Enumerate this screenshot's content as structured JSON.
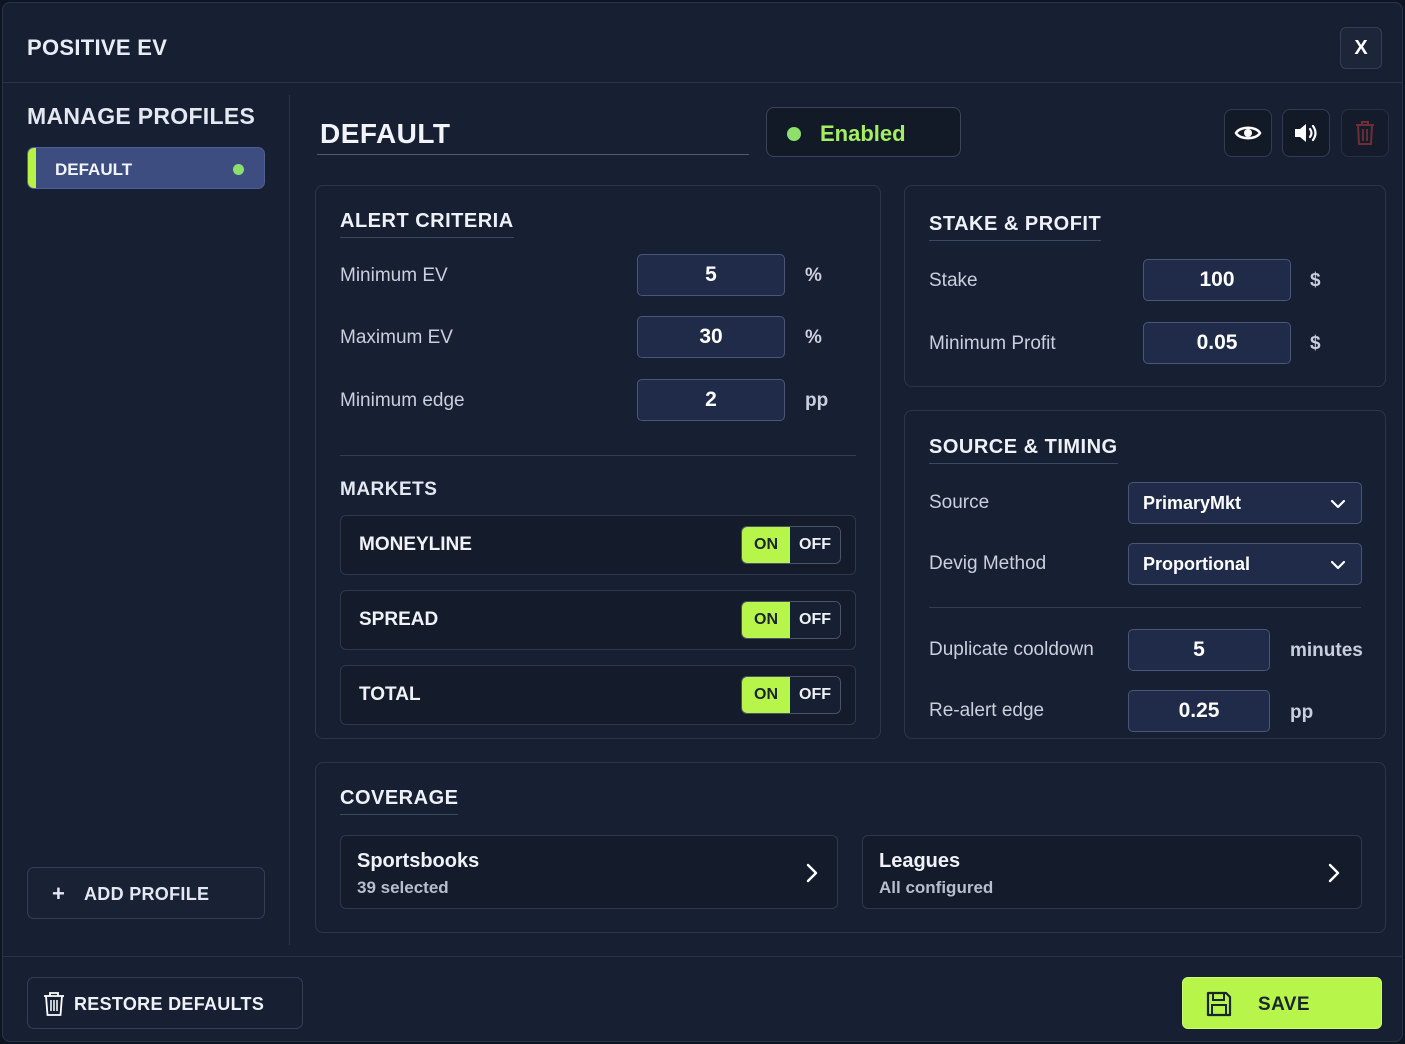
{
  "window": {
    "title": "POSITIVE EV",
    "close_label": "X"
  },
  "sidebar": {
    "title": "MANAGE PROFILES",
    "profiles": [
      {
        "label": "DEFAULT",
        "active": true
      }
    ],
    "add_profile_label": "ADD PROFILE",
    "add_icon": "+"
  },
  "profile": {
    "name": "DEFAULT",
    "status_label": "Enabled"
  },
  "toolbar": {
    "icons": [
      "eye-icon",
      "speaker-icon",
      "trash-icon"
    ]
  },
  "alert_criteria": {
    "title": "ALERT CRITERIA",
    "fields": [
      {
        "label": "Minimum EV",
        "value": "5",
        "unit": "%"
      },
      {
        "label": "Maximum EV",
        "value": "30",
        "unit": "%"
      },
      {
        "label": "Minimum edge",
        "value": "2",
        "unit": "pp"
      }
    ]
  },
  "markets": {
    "title": "MARKETS",
    "on_label": "ON",
    "off_label": "OFF",
    "items": [
      {
        "label": "MONEYLINE",
        "state": "ON"
      },
      {
        "label": "SPREAD",
        "state": "ON"
      },
      {
        "label": "TOTAL",
        "state": "ON"
      }
    ]
  },
  "stake_profit": {
    "title": "STAKE & PROFIT",
    "fields": [
      {
        "label": "Stake",
        "value": "100",
        "unit": "$"
      },
      {
        "label": "Minimum Profit",
        "value": "0.05",
        "unit": "$"
      }
    ]
  },
  "source_timing": {
    "title": "SOURCE & TIMING",
    "source": {
      "label": "Source",
      "value": "PrimaryMkt"
    },
    "devig": {
      "label": "Devig Method",
      "value": "Proportional"
    },
    "cooldown": {
      "label": "Duplicate cooldown",
      "value": "5",
      "unit": "minutes"
    },
    "realert": {
      "label": "Re-alert edge",
      "value": "0.25",
      "unit": "pp"
    }
  },
  "coverage": {
    "title": "COVERAGE",
    "sportsbooks": {
      "title": "Sportsbooks",
      "subtitle": "39 selected"
    },
    "leagues": {
      "title": "Leagues",
      "subtitle": "All configured"
    }
  },
  "footer": {
    "restore_label": "RESTORE DEFAULTS",
    "save_label": "SAVE"
  },
  "colors": {
    "accent": "#b8f54a",
    "enabled_text": "#a4ee63",
    "background": "#172033",
    "input_bg": "#1f2b48"
  }
}
